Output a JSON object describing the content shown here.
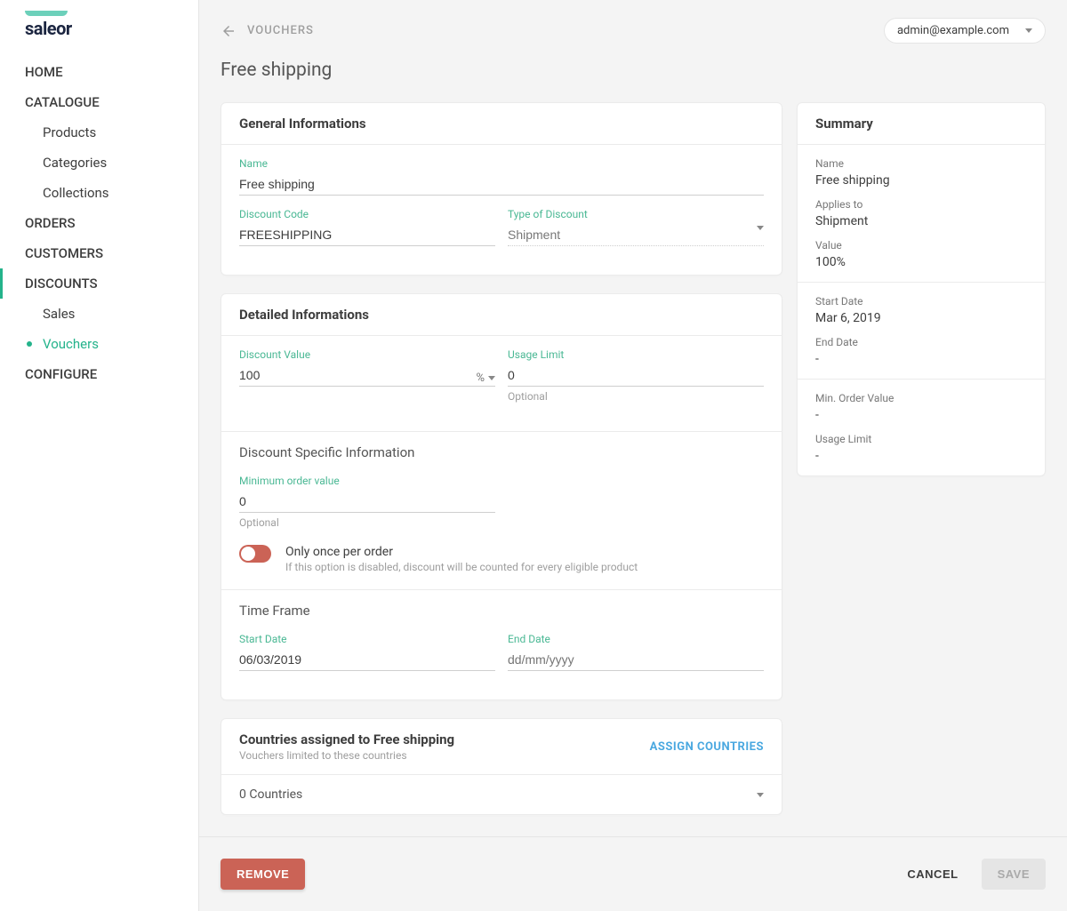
{
  "logo": "saleor",
  "user_email": "admin@example.com",
  "breadcrumb": "VOUCHERS",
  "page_title": "Free shipping",
  "nav": {
    "home": "HOME",
    "catalogue": "CATALOGUE",
    "products": "Products",
    "categories": "Categories",
    "collections": "Collections",
    "orders": "ORDERS",
    "customers": "CUSTOMERS",
    "discounts": "DISCOUNTS",
    "sales": "Sales",
    "vouchers": "Vouchers",
    "configure": "CONFIGURE"
  },
  "general": {
    "heading": "General Informations",
    "name_label": "Name",
    "name_value": "Free shipping",
    "code_label": "Discount Code",
    "code_value": "FREESHIPPING",
    "type_label": "Type of Discount",
    "type_value": "Shipment"
  },
  "detailed": {
    "heading": "Detailed Informations",
    "value_label": "Discount Value",
    "value_value": "100",
    "value_unit": "%",
    "usage_label": "Usage Limit",
    "usage_value": "0",
    "usage_helper": "Optional",
    "specific_heading": "Discount Specific Information",
    "minorder_label": "Minimum order value",
    "minorder_value": "0",
    "minorder_helper": "Optional",
    "once_title": "Only once per order",
    "once_sub": "If this option is disabled, discount will be counted for every eligible product",
    "timeframe_heading": "Time Frame",
    "start_label": "Start Date",
    "start_value": "06/03/2019",
    "end_label": "End Date",
    "end_placeholder": "dd/mm/yyyy"
  },
  "countries": {
    "heading": "Countries assigned to Free shipping",
    "sub": "Vouchers limited to these countries",
    "assign": "ASSIGN COUNTRIES",
    "count_text": "0 Countries"
  },
  "summary": {
    "heading": "Summary",
    "name_label": "Name",
    "name_value": "Free shipping",
    "applies_label": "Applies to",
    "applies_value": "Shipment",
    "value_label": "Value",
    "value_value": "100%",
    "startdate_label": "Start Date",
    "startdate_value": "Mar 6, 2019",
    "enddate_label": "End Date",
    "enddate_value": "-",
    "minorder_label": "Min. Order Value",
    "minorder_value": "-",
    "usage_label": "Usage Limit",
    "usage_value": "-"
  },
  "footer": {
    "remove": "REMOVE",
    "cancel": "CANCEL",
    "save": "SAVE"
  }
}
